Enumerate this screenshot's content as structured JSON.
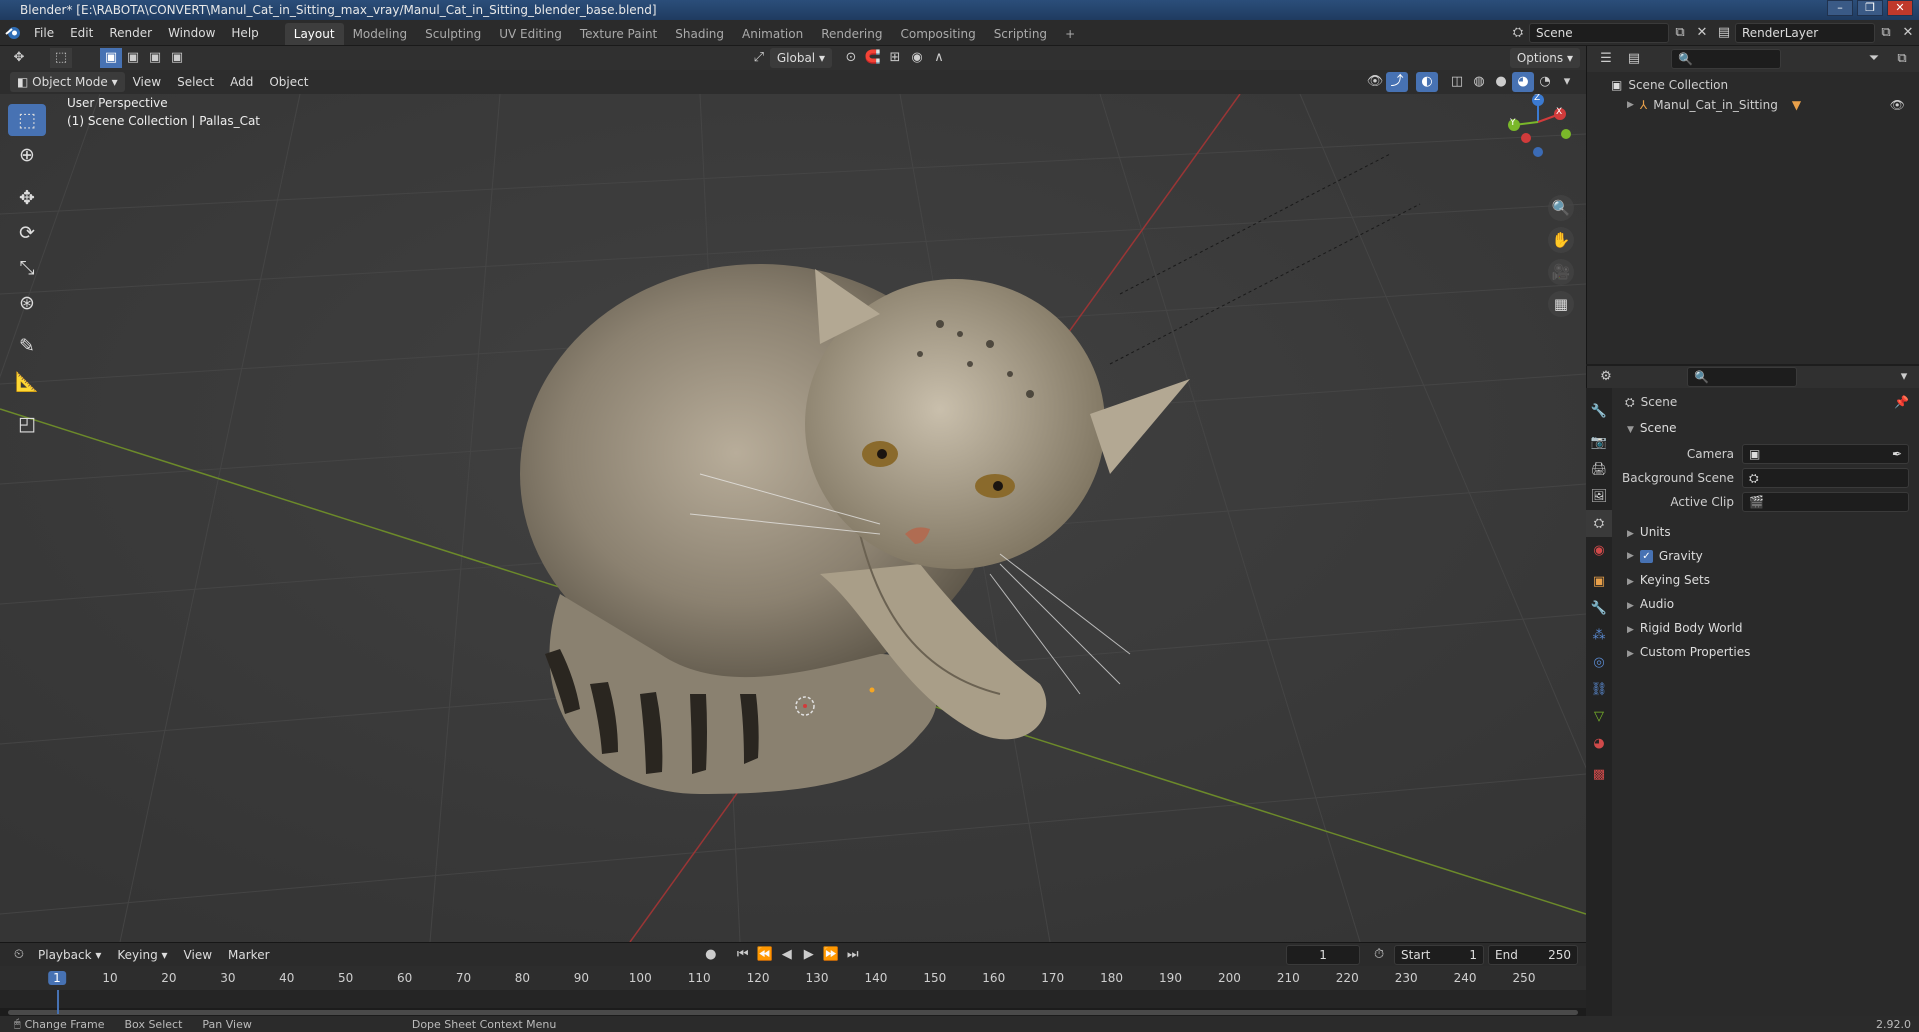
{
  "window": {
    "title": "Blender* [E:\\RABOTA\\CONVERT\\Manul_Cat_in_Sitting_max_vray/Manul_Cat_in_Sitting_blender_base.blend]"
  },
  "menu": [
    "File",
    "Edit",
    "Render",
    "Window",
    "Help"
  ],
  "workspaces": [
    "Layout",
    "Modeling",
    "Sculpting",
    "UV Editing",
    "Texture Paint",
    "Shading",
    "Animation",
    "Rendering",
    "Compositing",
    "Scripting"
  ],
  "topbar": {
    "scene": "Scene",
    "render_layer": "RenderLayer"
  },
  "tool_header": {
    "orientation": "Global",
    "options": "Options"
  },
  "viewport_header": {
    "mode": "Object Mode",
    "menus": [
      "View",
      "Select",
      "Add",
      "Object"
    ]
  },
  "viewport": {
    "perspective": "User Perspective",
    "collection": "(1) Scene Collection | Pallas_Cat",
    "gizmo_axes": {
      "z": "Z",
      "y": "Y",
      "x": "X"
    }
  },
  "outliner": {
    "root": "Scene Collection",
    "items": [
      {
        "name": "Manul_Cat_in_Sitting"
      }
    ]
  },
  "properties": {
    "context": "Scene",
    "section": "Scene",
    "fields": {
      "camera_label": "Camera",
      "background_label": "Background Scene",
      "clip_label": "Active Clip"
    },
    "panels": [
      "Units",
      "Gravity",
      "Keying Sets",
      "Audio",
      "Rigid Body World",
      "Custom Properties"
    ],
    "gravity_checked": true
  },
  "timeline": {
    "menus": [
      "Playback",
      "Keying",
      "View",
      "Marker"
    ],
    "current_frame": "1",
    "start_label": "Start",
    "start": "1",
    "end_label": "End",
    "end": "250",
    "ruler": [
      "1",
      "10",
      "20",
      "30",
      "40",
      "50",
      "60",
      "70",
      "80",
      "90",
      "100",
      "110",
      "120",
      "130",
      "140",
      "150",
      "160",
      "170",
      "180",
      "190",
      "200",
      "210",
      "220",
      "230",
      "240",
      "250"
    ]
  },
  "status_bar": {
    "items": [
      "Change Frame",
      "Box Select",
      "Pan View",
      "Dope Sheet Context Menu"
    ],
    "version": "2.92.0"
  },
  "colors": {
    "accent": "#4772b3",
    "x_axis": "#d13b3b",
    "y_axis": "#7ab82a",
    "z_axis": "#3b7ad1"
  }
}
